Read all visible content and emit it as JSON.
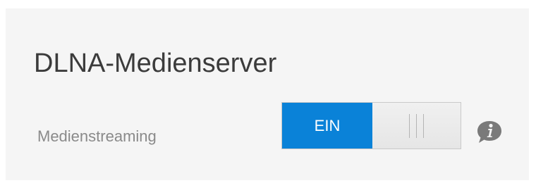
{
  "section": {
    "title": "DLNA-Medienserver"
  },
  "settings": {
    "media_streaming": {
      "label": "Medienstreaming",
      "state_label": "EIN",
      "enabled": true
    }
  },
  "icons": {
    "info": "info-speech-bubble-icon",
    "toggle_handle": "grip-lines-icon"
  },
  "colors": {
    "toggle_on": "#0a82d8",
    "title_text": "#3b3b3b",
    "label_text": "#8a8a8a",
    "info_icon": "#7a7a7a"
  }
}
